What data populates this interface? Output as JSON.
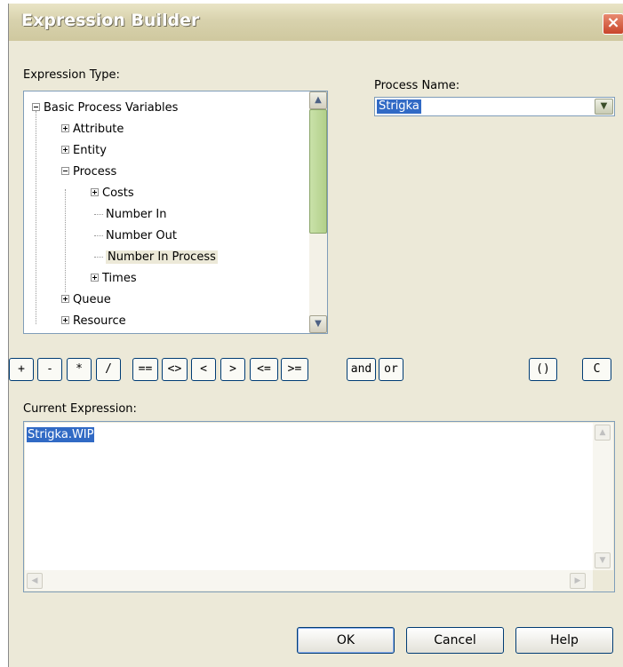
{
  "window": {
    "title": "Expression Builder",
    "close_symbol": "×"
  },
  "expression_type": {
    "label": "Expression Type:",
    "tree": [
      {
        "label": "Basic Process Variables",
        "expander": "minus"
      },
      {
        "label": "Attribute",
        "expander": "plus"
      },
      {
        "label": "Entity",
        "expander": "plus"
      },
      {
        "label": "Process",
        "expander": "minus"
      },
      {
        "label": "Costs",
        "expander": "plus"
      },
      {
        "label": "Number In",
        "expander": "none"
      },
      {
        "label": "Number Out",
        "expander": "none"
      },
      {
        "label": "Number In Process",
        "expander": "none",
        "selected": true
      },
      {
        "label": "Times",
        "expander": "plus"
      },
      {
        "label": "Queue",
        "expander": "plus"
      },
      {
        "label": "Resource",
        "expander": "plus"
      }
    ]
  },
  "process_name": {
    "label": "Process Name:",
    "value": "Strigka"
  },
  "operators": [
    "+",
    "-",
    "*",
    "/",
    "==",
    "<>",
    "<",
    ">",
    "<=",
    ">=",
    "and",
    "or",
    "()",
    "C"
  ],
  "current_expression": {
    "label": "Current Expression:",
    "value": "Strigka.WIP"
  },
  "buttons": {
    "ok": "OK",
    "cancel": "Cancel",
    "help": "Help"
  },
  "icons": {
    "scroll_up": "▲",
    "scroll_down": "▼",
    "scroll_left": "◀",
    "scroll_right": "▶",
    "combo_arrow": "▼"
  },
  "colors": {
    "selection": "#316ac5",
    "scroll_thumb": "#b2d08a",
    "dialog_bg": "#ece9d8"
  }
}
